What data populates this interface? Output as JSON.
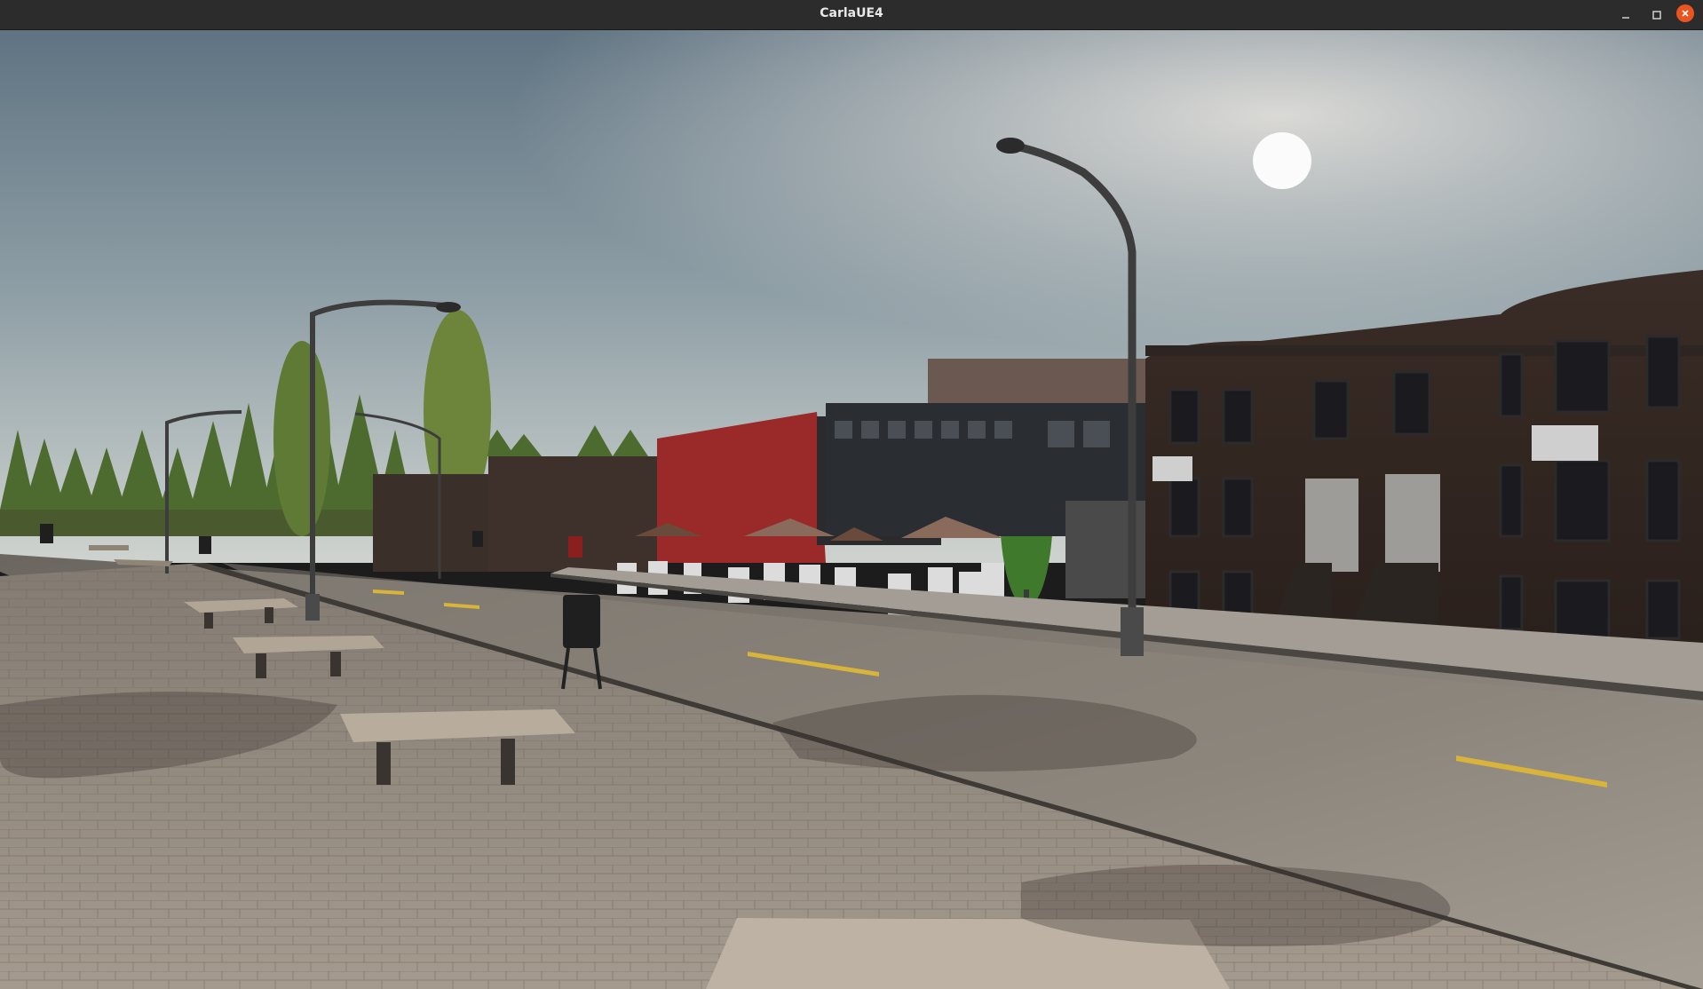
{
  "window": {
    "title": "CarlaUE4",
    "controls": {
      "minimize_icon": "minimize-icon",
      "maximize_icon": "maximize-icon",
      "close_icon": "close-icon"
    },
    "accent_colors": {
      "titlebar": "#2c2c2c",
      "close_button": "#e95420"
    }
  },
  "scene": {
    "description_type": "3d-simulation-viewport"
  }
}
